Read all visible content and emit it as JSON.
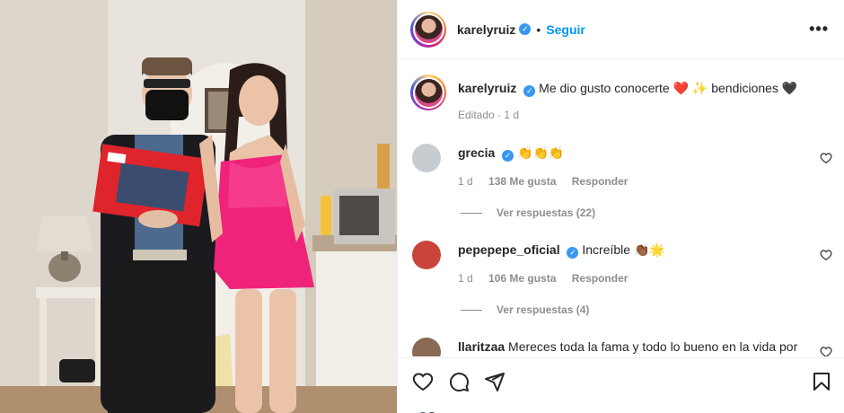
{
  "post": {
    "username": "karelyruiz",
    "follow_label": "Seguir",
    "separator": "•",
    "more_label": "•••"
  },
  "caption": {
    "username": "karelyruiz",
    "text": "Me dio gusto conocerte ❤️ ✨ bendiciones 🖤",
    "meta": "Editado · 1 d"
  },
  "comments": [
    {
      "username": "grecia",
      "verified": true,
      "text": "👏👏👏",
      "time": "1 d",
      "likes": "138 Me gusta",
      "reply": "Responder",
      "replies": "Ver respuestas (22)",
      "avatar_color": "#c7ccd0"
    },
    {
      "username": "pepepepe_oficial",
      "verified": true,
      "text": "Increíble 👏🏾🌟",
      "time": "1 d",
      "likes": "106 Me gusta",
      "reply": "Responder",
      "replies": "Ver respuestas (4)",
      "avatar_color": "#c9443a"
    },
    {
      "username": "llaritzaa",
      "verified": false,
      "text": "Mereces toda la fama y todo lo bueno en la vida por",
      "avatar_color": "#8a6a55"
    }
  ],
  "icons": [
    "heart-icon",
    "comment-icon",
    "share-icon",
    "bookmark-icon",
    "more-icon",
    "verified-icon"
  ],
  "colors": {
    "accent": "#0095f6",
    "verified": "#3897f0",
    "dress": "#f0237a",
    "switch_box": "#e0242c"
  }
}
